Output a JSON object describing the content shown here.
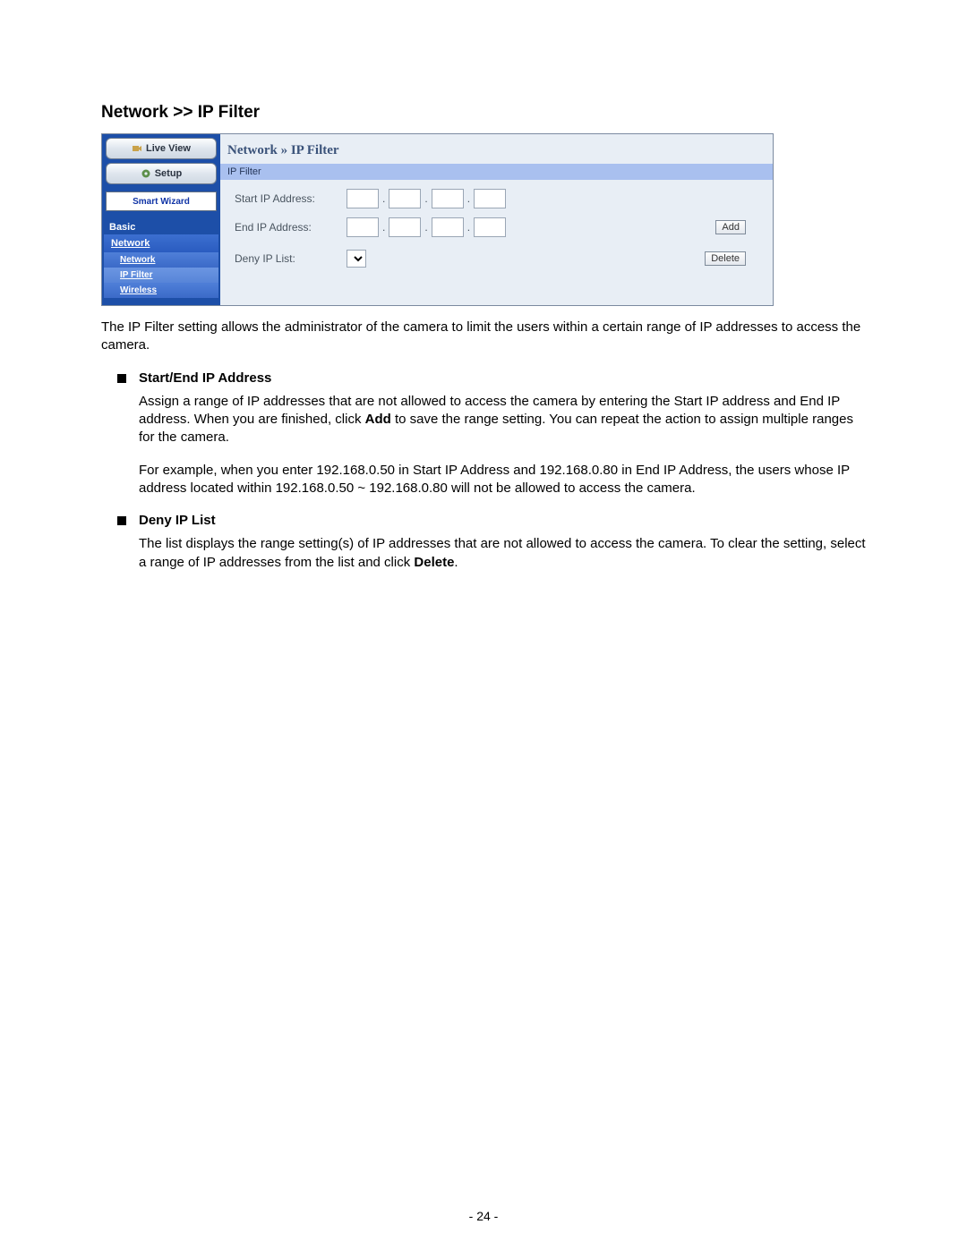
{
  "page": {
    "title": "Network >> IP Filter",
    "number_label": "- 24 -"
  },
  "ui": {
    "sidebar": {
      "live_view": "Live View",
      "setup": "Setup",
      "smart_wizard": "Smart Wizard",
      "section_basic": "Basic",
      "cat_network": "Network",
      "sub_network": "Network",
      "sub_ipfilter": "IP Filter",
      "sub_wireless": "Wireless"
    },
    "breadcrumb": "Network » IP Filter",
    "section_label": "IP Filter",
    "labels": {
      "start_ip": "Start IP Address:",
      "end_ip": "End IP Address:",
      "deny_list": "Deny IP List:"
    },
    "buttons": {
      "add": "Add",
      "delete": "Delete"
    },
    "ip_values": {
      "start": [
        "",
        "",
        "",
        ""
      ],
      "end": [
        "",
        "",
        "",
        ""
      ]
    },
    "deny_options": []
  },
  "text": {
    "intro": "The IP Filter setting allows the administrator of the camera to limit the users within a certain range of IP addresses to access the camera.",
    "h1": "Start/End IP Address",
    "p1a_pre": "Assign a range of IP addresses that are not allowed to access the camera by entering the Start IP address and End IP address. When you are finished, click ",
    "p1a_bold": "Add",
    "p1a_post": " to save the range setting. You can repeat the action to assign multiple ranges for the camera.",
    "p1b": "For example, when you enter 192.168.0.50 in Start IP Address and 192.168.0.80 in End IP Address, the users whose IP address located within 192.168.0.50 ~ 192.168.0.80 will not be allowed to access the camera.",
    "h2": "Deny IP List",
    "p2_pre": "The list displays the range setting(s) of IP addresses that are not allowed to access the camera. To clear the setting, select a range of IP addresses from the list and click ",
    "p2_bold": "Delete",
    "p2_post": "."
  }
}
